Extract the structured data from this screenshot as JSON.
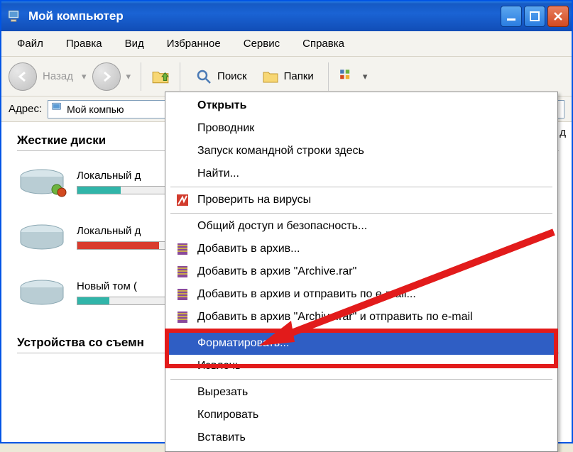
{
  "window": {
    "title": "Мой компьютер"
  },
  "menubar": [
    "Файл",
    "Правка",
    "Вид",
    "Избранное",
    "Сервис",
    "Справка"
  ],
  "toolbar": {
    "back": "Назад",
    "search": "Поиск",
    "folders": "Папки"
  },
  "address": {
    "label": "Адрес:",
    "value": "Мой компью"
  },
  "sections": {
    "hdd": "Жесткие диски",
    "removable": "Устройства со съемн"
  },
  "drives": [
    {
      "name": "Локальный д",
      "fill_pct": 48,
      "fill_color": "teal"
    },
    {
      "name": "Локальный д",
      "fill_pct": 90,
      "fill_color": "red"
    },
    {
      "name": "Новый том (",
      "fill_pct": 35,
      "fill_color": "teal"
    }
  ],
  "context_menu": {
    "items": [
      {
        "label": "Открыть",
        "bold": true,
        "icon": ""
      },
      {
        "label": "Проводник",
        "icon": ""
      },
      {
        "label": "Запуск командной строки здесь",
        "icon": ""
      },
      {
        "label": "Найти...",
        "icon": ""
      },
      {
        "sep": true
      },
      {
        "label": "Проверить на вирусы",
        "icon": "kaspersky"
      },
      {
        "sep": true
      },
      {
        "label": "Общий доступ и безопасность...",
        "icon": ""
      },
      {
        "label": "Добавить в архив...",
        "icon": "winrar"
      },
      {
        "label": "Добавить в архив \"Archive.rar\"",
        "icon": "winrar"
      },
      {
        "label": "Добавить в архив и отправить по e-mail...",
        "icon": "winrar"
      },
      {
        "label": "Добавить в архив \"Archive.rar\" и отправить по e-mail",
        "icon": "winrar"
      },
      {
        "sep": true
      },
      {
        "label": "Форматировать...",
        "highlighted": true,
        "icon": ""
      },
      {
        "label": "Извлечь",
        "icon": ""
      },
      {
        "sep": true
      },
      {
        "label": "Вырезать",
        "icon": ""
      },
      {
        "label": "Копировать",
        "icon": ""
      },
      {
        "label": "Вставить",
        "icon": ""
      }
    ]
  },
  "right_edge_char": "д"
}
